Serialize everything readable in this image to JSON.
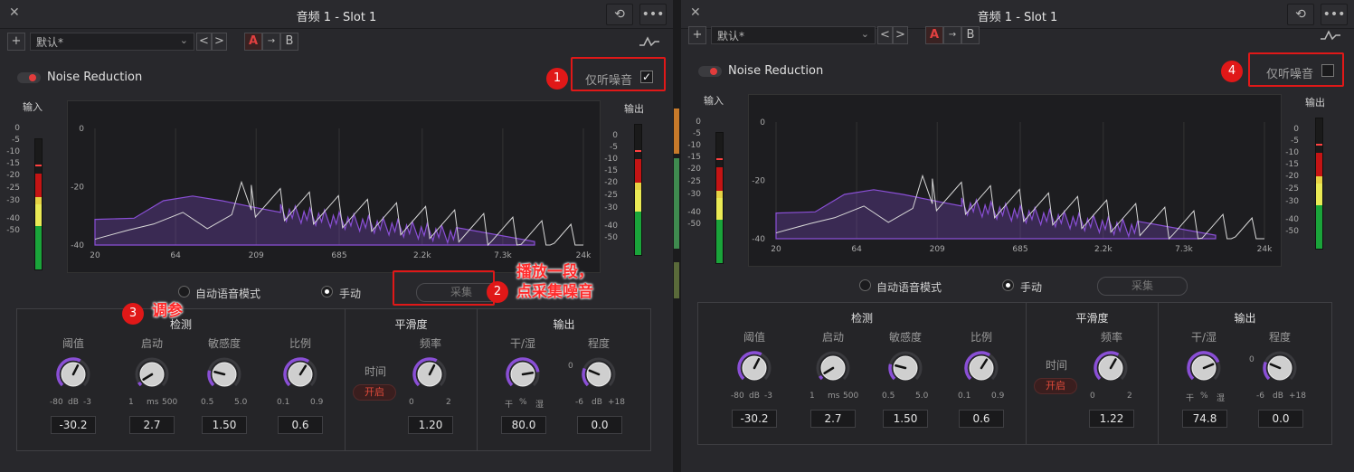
{
  "colors": {
    "accent": "#8a4fd6",
    "record": "#e23c3c",
    "annotation": "#e01818"
  },
  "icons": {
    "close": "close-icon",
    "history": "history-icon",
    "more": "more-icon",
    "add": "plus-icon",
    "curve": "curve-icon"
  },
  "left": {
    "title": "音频 1 - Slot 1",
    "preset": "默认*",
    "ab": {
      "a": "A",
      "copy": "→",
      "b": "B"
    },
    "nav": {
      "prev": "<",
      "next": ">"
    },
    "plugin_name": "Noise Reduction",
    "listen_label": "仅听噪音",
    "listen_checked": "✓",
    "input_label": "输入",
    "output_label": "输出",
    "meter_ticks": [
      "0",
      "-5",
      "-10",
      "-15",
      "-20",
      "-25",
      "-30",
      "-40",
      "-50"
    ],
    "spectrum_y": [
      "0",
      "-20",
      "-40"
    ],
    "spectrum_x": [
      "20",
      "64",
      "209",
      "685",
      "2.2k",
      "7.3k",
      "24k"
    ],
    "mode_auto": "自动语音模式",
    "mode_manual": "手动",
    "capture": "采集",
    "detect": {
      "title": "检测",
      "params": [
        {
          "label": "阈值",
          "min": "-80",
          "unit": "dB",
          "max": "-3",
          "value": "-30.2",
          "level": 0.6
        },
        {
          "label": "启动",
          "min": "1",
          "unit": "ms",
          "max": "500",
          "value": "2.7",
          "level": 0.05
        },
        {
          "label": "敏感度",
          "min": "0.5",
          "unit": "",
          "max": "5.0",
          "value": "1.50",
          "level": 0.22
        },
        {
          "label": "比例",
          "min": "0.1",
          "unit": "",
          "max": "0.9",
          "value": "0.6",
          "level": 0.62
        }
      ]
    },
    "smooth": {
      "title": "平滑度",
      "time": "时间",
      "on": "开启",
      "freq": {
        "label": "频率",
        "min": "0",
        "max": "2",
        "value": "1.20",
        "level": 0.6
      }
    },
    "output": {
      "title": "输出",
      "drywet": {
        "label": "干/湿",
        "min": "干",
        "unit": "%",
        "max": "湿",
        "value": "80.0",
        "level": 0.8
      },
      "amount": {
        "label": "程度",
        "min": "-6",
        "unit": "dB",
        "max": "+18",
        "zero": "0",
        "value": "0.0",
        "level": 0.25
      }
    },
    "badges": [
      "1",
      "2",
      "3"
    ],
    "anno_capture": [
      "播放一段，",
      "点采集噪音"
    ],
    "anno_tune": "调参"
  },
  "right": {
    "title": "音频 1 - Slot 1",
    "preset": "默认*",
    "ab": {
      "a": "A",
      "copy": "→",
      "b": "B"
    },
    "nav": {
      "prev": "<",
      "next": ">"
    },
    "plugin_name": "Noise Reduction",
    "listen_label": "仅听噪音",
    "input_label": "输入",
    "output_label": "输出",
    "meter_ticks": [
      "0",
      "-5",
      "-10",
      "-15",
      "-20",
      "-25",
      "-30",
      "-40",
      "-50"
    ],
    "spectrum_y": [
      "0",
      "-20",
      "-40"
    ],
    "spectrum_x": [
      "20",
      "64",
      "209",
      "685",
      "2.2k",
      "7.3k",
      "24k"
    ],
    "mode_auto": "自动语音模式",
    "mode_manual": "手动",
    "capture": "采集",
    "detect": {
      "title": "检测",
      "params": [
        {
          "label": "阈值",
          "min": "-80",
          "unit": "dB",
          "max": "-3",
          "value": "-30.2",
          "level": 0.6
        },
        {
          "label": "启动",
          "min": "1",
          "unit": "ms",
          "max": "500",
          "value": "2.7",
          "level": 0.05
        },
        {
          "label": "敏感度",
          "min": "0.5",
          "unit": "",
          "max": "5.0",
          "value": "1.50",
          "level": 0.22
        },
        {
          "label": "比例",
          "min": "0.1",
          "unit": "",
          "max": "0.9",
          "value": "0.6",
          "level": 0.62
        }
      ]
    },
    "smooth": {
      "title": "平滑度",
      "time": "时间",
      "on": "开启",
      "freq": {
        "label": "频率",
        "min": "0",
        "max": "2",
        "value": "1.22",
        "level": 0.61
      }
    },
    "output": {
      "title": "输出",
      "drywet": {
        "label": "干/湿",
        "min": "干",
        "unit": "%",
        "max": "湿",
        "value": "74.8",
        "level": 0.75
      },
      "amount": {
        "label": "程度",
        "min": "-6",
        "unit": "dB",
        "max": "+18",
        "zero": "0",
        "value": "0.0",
        "level": 0.25
      }
    },
    "badge": "4"
  }
}
